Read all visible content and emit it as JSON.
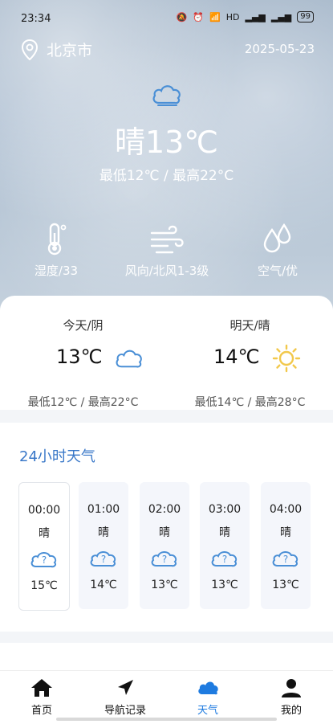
{
  "status": {
    "time": "23:34",
    "icons_text": "HD",
    "battery": "99"
  },
  "header": {
    "city": "北京市",
    "date": "2025-05-23"
  },
  "current": {
    "temp_text": "晴13℃",
    "range_text": "最低12℃ / 最高22°C",
    "metrics": [
      {
        "label": "湿度/33",
        "icon": "thermometer-icon"
      },
      {
        "label": "风向/北风1-3级",
        "icon": "wind-icon"
      },
      {
        "label": "空气/优",
        "icon": "water-drops-icon"
      }
    ]
  },
  "days": [
    {
      "title": "今天/阴",
      "temp": "13℃",
      "range": "最低12℃ / 最高22°C",
      "icon": "cloud-icon"
    },
    {
      "title": "明天/晴",
      "temp": "14℃",
      "range": "最低14℃ / 最高28°C",
      "icon": "sun-icon"
    }
  ],
  "hourly": {
    "title": "24小时天气",
    "items": [
      {
        "time": "00:00",
        "weather": "晴",
        "temp": "15℃"
      },
      {
        "time": "01:00",
        "weather": "晴",
        "temp": "14℃"
      },
      {
        "time": "02:00",
        "weather": "晴",
        "temp": "13℃"
      },
      {
        "time": "03:00",
        "weather": "晴",
        "temp": "13℃"
      },
      {
        "time": "04:00",
        "weather": "晴",
        "temp": "13℃"
      }
    ]
  },
  "nav": {
    "items": [
      {
        "label": "首页",
        "icon": "home-icon"
      },
      {
        "label": "导航记录",
        "icon": "navigation-arrow-icon"
      },
      {
        "label": "天气",
        "icon": "cloud-icon"
      },
      {
        "label": "我的",
        "icon": "user-icon"
      }
    ],
    "active_color": "#1e7be0"
  },
  "colors": {
    "accent": "#3a78c8",
    "icon_blue": "#4a8fd6",
    "sun": "#f2c84b"
  }
}
